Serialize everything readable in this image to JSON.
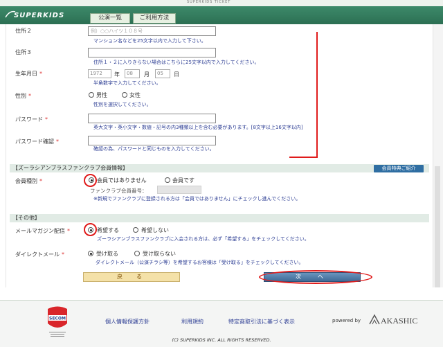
{
  "topbar": {
    "small_text": "SUPERKIDS TICKET"
  },
  "header": {
    "logo": "SUPERKIDS",
    "nav": [
      {
        "label": "公演一覧"
      },
      {
        "label": "ご利用方法"
      }
    ]
  },
  "form": {
    "address2": {
      "label": "住所２",
      "placeholder": "例）○○ハイツ１０８号",
      "hint": "マンション名などを25文字以内で入力して下さい。"
    },
    "address3": {
      "label": "住所３",
      "hint": "住所１・２に入りきらない場合はこちらに25文字以内で入力してください。"
    },
    "birthday": {
      "label": "生年月日",
      "year": "1972",
      "year_unit": "年",
      "month": "08",
      "month_unit": "月",
      "day": "05",
      "day_unit": "日",
      "hint": "半角数字で入力してください。"
    },
    "gender": {
      "label": "性別",
      "options": [
        {
          "label": "男性",
          "selected": false
        },
        {
          "label": "女性",
          "selected": false
        }
      ],
      "hint": "性別を選択してください。"
    },
    "password": {
      "label": "パスワード",
      "hint": "英大文字・英小文字・数値・記号の内3種類以上を含む必要があります。[8文字以上16文字以内]"
    },
    "password_confirm": {
      "label": "パスワード確認",
      "hint": "確認の為、パスワードと同じものを入力してください。"
    },
    "required_mark": "*"
  },
  "fanclub": {
    "section_title": "【ズーラシアンブラスファンクラブ会員情報】",
    "benefit_button": "会員特典ご紹介",
    "member_type": {
      "label": "会員種別",
      "options": [
        {
          "label": "会員ではありません",
          "selected": true
        },
        {
          "label": "会員です",
          "selected": false
        }
      ]
    },
    "member_no_label": "ファンクラブ会員番号：",
    "note": "※新規でファンクラブに登録される方は「会員ではありません」にチェックし進んでください。"
  },
  "other": {
    "section_title": "【その他】",
    "magazine": {
      "label": "メールマガジン配信",
      "options": [
        {
          "label": "希望する",
          "selected": true
        },
        {
          "label": "希望しない",
          "selected": false
        }
      ],
      "hint": "ズーラシアンブラスファンクラブに入会される方は、必ず「希望する」をチェックしてください。"
    },
    "direct_mail": {
      "label": "ダイレクトメール",
      "options": [
        {
          "label": "受け取る",
          "selected": true
        },
        {
          "label": "受け取らない",
          "selected": false
        }
      ],
      "hint": "ダイレクトメール（公演チラシ等）を希望するお客様は「受け取る」をチェックしてください。"
    }
  },
  "buttons": {
    "back": "戻　る",
    "next": "次　へ"
  },
  "footer": {
    "links": [
      "個人情報保護方針",
      "利用規約",
      "特定商取引法に基づく表示"
    ],
    "powered_by": "powered by",
    "brand": "AKASHIC",
    "seal_text": "SECOM",
    "copyright": "(C) SUPERKIDS INC. ALL RIGHTS RESERVED."
  },
  "colors": {
    "header": "#2c6f53",
    "section": "#e1ebe5",
    "hint": "#2b3c93",
    "annotation": "#e01b1b"
  }
}
